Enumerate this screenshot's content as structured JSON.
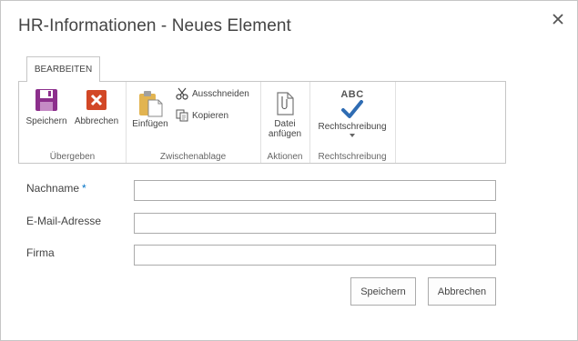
{
  "dialog": {
    "title": "HR-Informationen - Neues Element",
    "close_icon": "close-icon"
  },
  "ribbon": {
    "tab_label": "BEARBEITEN",
    "groups": {
      "commit": {
        "label": "Übergeben",
        "save": "Speichern",
        "cancel": "Abbrechen"
      },
      "clipboard": {
        "label": "Zwischenablage",
        "paste": "Einfügen",
        "cut": "Ausschneiden",
        "copy": "Kopieren"
      },
      "actions": {
        "label": "Aktionen",
        "attach_line1": "Datei",
        "attach_line2": "anfügen"
      },
      "spelling": {
        "label": "Rechtschreibung",
        "spelling_button": "Rechtschreibung",
        "abc": "ABC"
      }
    }
  },
  "form": {
    "fields": [
      {
        "label": "Nachname",
        "required": "*",
        "value": ""
      },
      {
        "label": "E-Mail-Adresse",
        "value": ""
      },
      {
        "label": "Firma",
        "value": ""
      }
    ],
    "save_button": "Speichern",
    "cancel_button": "Abbrechen"
  },
  "colors": {
    "accent": "#0072c6",
    "save_icon": "#8c2f8c",
    "cancel_icon": "#d24726",
    "check_icon": "#2f6cb3"
  }
}
